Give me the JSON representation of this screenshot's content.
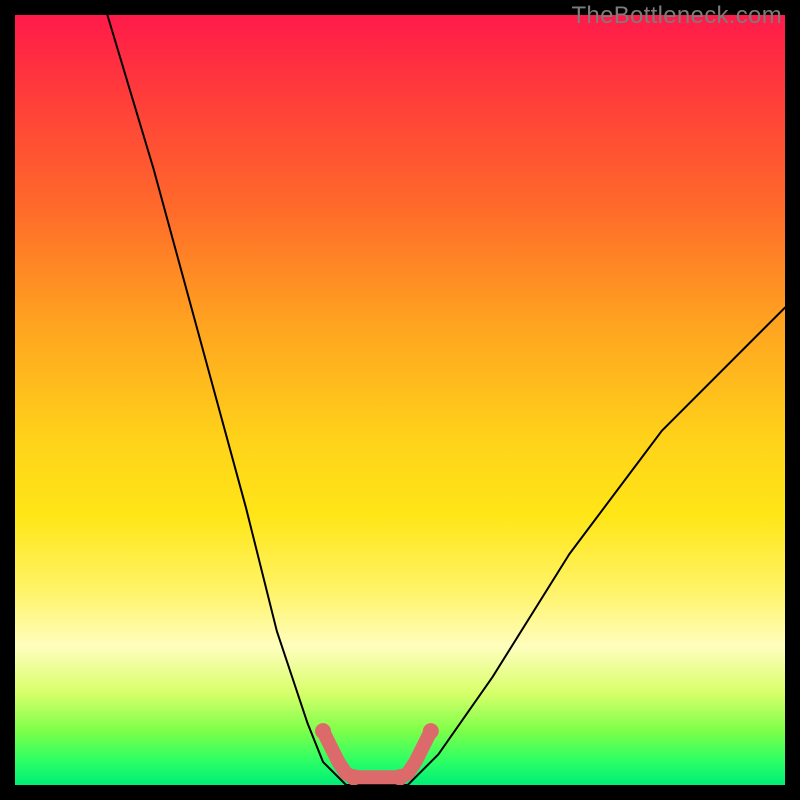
{
  "watermark": {
    "text": "TheBottleneck.com"
  },
  "chart_data": {
    "type": "line",
    "title": "",
    "xlabel": "",
    "ylabel": "",
    "xlim": [
      0,
      100
    ],
    "ylim": [
      0,
      100
    ],
    "grid": false,
    "legend": false,
    "series": [
      {
        "name": "black-curve-left",
        "color": "#000000",
        "x": [
          12,
          18,
          24,
          30,
          34,
          38,
          40,
          43
        ],
        "y": [
          100,
          80,
          58,
          36,
          20,
          8,
          3,
          0
        ]
      },
      {
        "name": "black-curve-right",
        "color": "#000000",
        "x": [
          51,
          55,
          62,
          72,
          84,
          100
        ],
        "y": [
          0,
          4,
          14,
          30,
          46,
          62
        ]
      },
      {
        "name": "black-flat",
        "color": "#000000",
        "x": [
          43,
          51
        ],
        "y": [
          0,
          0
        ]
      },
      {
        "name": "pink-bracket-left",
        "color": "#dd6a6a",
        "x": [
          40,
          41,
          42,
          43,
          44
        ],
        "y": [
          7,
          5,
          3,
          1.5,
          1
        ]
      },
      {
        "name": "pink-bracket-flat",
        "color": "#dd6a6a",
        "x": [
          44,
          45,
          46,
          47,
          48,
          49,
          50
        ],
        "y": [
          1,
          1,
          1,
          1,
          1,
          1,
          1
        ]
      },
      {
        "name": "pink-bracket-right",
        "color": "#dd6a6a",
        "x": [
          50,
          51,
          52,
          53,
          54
        ],
        "y": [
          1,
          1.5,
          3,
          5,
          7
        ]
      }
    ]
  }
}
